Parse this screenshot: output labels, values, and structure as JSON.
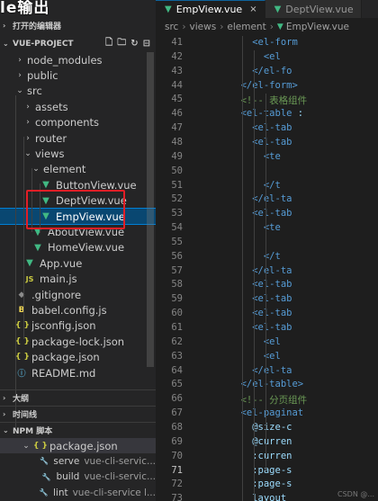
{
  "overlay_title": "le输出",
  "explorer": {
    "open_editors_label": "打开的编辑器",
    "project_label": "VUE-PROJECT",
    "tree": [
      {
        "label": "node_modules",
        "kind": "folder",
        "depth": 1,
        "expanded": false
      },
      {
        "label": "public",
        "kind": "folder",
        "depth": 1,
        "expanded": false
      },
      {
        "label": "src",
        "kind": "folder",
        "depth": 1,
        "expanded": true
      },
      {
        "label": "assets",
        "kind": "folder",
        "depth": 2,
        "expanded": false
      },
      {
        "label": "components",
        "kind": "folder",
        "depth": 2,
        "expanded": false
      },
      {
        "label": "router",
        "kind": "folder",
        "depth": 2,
        "expanded": false
      },
      {
        "label": "views",
        "kind": "folder",
        "depth": 2,
        "expanded": true
      },
      {
        "label": "element",
        "kind": "folder",
        "depth": 3,
        "expanded": true
      },
      {
        "label": "ButtonView.vue",
        "kind": "vue",
        "depth": 4
      },
      {
        "label": "DeptView.vue",
        "kind": "vue",
        "depth": 4
      },
      {
        "label": "EmpView.vue",
        "kind": "vue",
        "depth": 4,
        "selected": true
      },
      {
        "label": "AboutView.vue",
        "kind": "vue",
        "depth": 3
      },
      {
        "label": "HomeView.vue",
        "kind": "vue",
        "depth": 3
      },
      {
        "label": "App.vue",
        "kind": "vue",
        "depth": 2
      },
      {
        "label": "main.js",
        "kind": "js",
        "depth": 2
      },
      {
        "label": ".gitignore",
        "kind": "git",
        "depth": 1
      },
      {
        "label": "babel.config.js",
        "kind": "babel",
        "depth": 1
      },
      {
        "label": "jsconfig.json",
        "kind": "json",
        "depth": 1
      },
      {
        "label": "package-lock.json",
        "kind": "json",
        "depth": 1
      },
      {
        "label": "package.json",
        "kind": "json",
        "depth": 1
      },
      {
        "label": "README.md",
        "kind": "info",
        "depth": 1
      }
    ],
    "outline_label": "大纲",
    "timeline_label": "时间线",
    "npm_label": "NPM 脚本",
    "npm_package": "package.json",
    "npm_scripts": [
      {
        "name": "serve",
        "cmd": "vue-cli-servic..."
      },
      {
        "name": "build",
        "cmd": "vue-cli-servic..."
      },
      {
        "name": "lint",
        "cmd": "vue-cli-service l..."
      }
    ]
  },
  "tabs": [
    {
      "label": "EmpView.vue",
      "active": true,
      "close": "×"
    },
    {
      "label": "DeptView.vue",
      "active": false
    }
  ],
  "breadcrumb": [
    "src",
    "views",
    "element",
    "EmpView.vue"
  ],
  "editor": {
    "current_line": 71,
    "lines": [
      {
        "n": "41",
        "indent": 10,
        "parts": [
          {
            "c": "tg",
            "t": "<el-form"
          }
        ]
      },
      {
        "n": "42",
        "indent": 12,
        "parts": [
          {
            "c": "tg",
            "t": "<el"
          }
        ]
      },
      {
        "n": "43",
        "indent": 10,
        "parts": [
          {
            "c": "tg",
            "t": "</el-fo"
          }
        ]
      },
      {
        "n": "44",
        "indent": 8,
        "parts": [
          {
            "c": "tg",
            "t": "</el-form>"
          }
        ]
      },
      {
        "n": "45",
        "indent": 8,
        "parts": [
          {
            "c": "cm",
            "t": "<!-- 表格组件"
          }
        ]
      },
      {
        "n": "46",
        "indent": 8,
        "parts": [
          {
            "c": "tg",
            "t": "<el-table"
          },
          {
            "c": "at",
            "t": " :"
          }
        ]
      },
      {
        "n": "47",
        "indent": 10,
        "parts": [
          {
            "c": "tg",
            "t": "<el-tab"
          }
        ]
      },
      {
        "n": "48",
        "indent": 10,
        "parts": [
          {
            "c": "tg",
            "t": "<el-tab"
          }
        ]
      },
      {
        "n": "49",
        "indent": 12,
        "parts": [
          {
            "c": "tg",
            "t": "<te"
          }
        ]
      },
      {
        "n": "50",
        "indent": 12,
        "parts": []
      },
      {
        "n": "51",
        "indent": 12,
        "parts": [
          {
            "c": "tg",
            "t": "</t"
          }
        ]
      },
      {
        "n": "52",
        "indent": 10,
        "parts": [
          {
            "c": "tg",
            "t": "</el-ta"
          }
        ]
      },
      {
        "n": "53",
        "indent": 10,
        "parts": [
          {
            "c": "tg",
            "t": "<el-tab"
          }
        ]
      },
      {
        "n": "54",
        "indent": 12,
        "parts": [
          {
            "c": "tg",
            "t": "<te"
          }
        ]
      },
      {
        "n": "55",
        "indent": 12,
        "parts": []
      },
      {
        "n": "56",
        "indent": 12,
        "parts": [
          {
            "c": "tg",
            "t": "</t"
          }
        ]
      },
      {
        "n": "57",
        "indent": 10,
        "parts": [
          {
            "c": "tg",
            "t": "</el-ta"
          }
        ]
      },
      {
        "n": "58",
        "indent": 10,
        "parts": [
          {
            "c": "tg",
            "t": "<el-tab"
          }
        ]
      },
      {
        "n": "59",
        "indent": 10,
        "parts": [
          {
            "c": "tg",
            "t": "<el-tab"
          }
        ]
      },
      {
        "n": "60",
        "indent": 10,
        "parts": [
          {
            "c": "tg",
            "t": "<el-tab"
          }
        ]
      },
      {
        "n": "61",
        "indent": 10,
        "parts": [
          {
            "c": "tg",
            "t": "<el-tab"
          }
        ]
      },
      {
        "n": "62",
        "indent": 12,
        "parts": [
          {
            "c": "tg",
            "t": "<el"
          }
        ]
      },
      {
        "n": "63",
        "indent": 12,
        "parts": [
          {
            "c": "tg",
            "t": "<el"
          }
        ]
      },
      {
        "n": "64",
        "indent": 10,
        "parts": [
          {
            "c": "tg",
            "t": "</el-ta"
          }
        ]
      },
      {
        "n": "65",
        "indent": 8,
        "parts": [
          {
            "c": "tg",
            "t": "</el-table>"
          }
        ]
      },
      {
        "n": "66",
        "indent": 8,
        "parts": [
          {
            "c": "cm",
            "t": "<!-- 分页组件"
          }
        ]
      },
      {
        "n": "67",
        "indent": 8,
        "parts": [
          {
            "c": "tg",
            "t": "<el-paginat"
          }
        ]
      },
      {
        "n": "68",
        "indent": 10,
        "parts": [
          {
            "c": "at",
            "t": "@size-c"
          }
        ]
      },
      {
        "n": "69",
        "indent": 10,
        "parts": [
          {
            "c": "at",
            "t": "@curren"
          }
        ]
      },
      {
        "n": "70",
        "indent": 10,
        "parts": [
          {
            "c": "at",
            "t": ":curren"
          }
        ]
      },
      {
        "n": "71",
        "indent": 10,
        "parts": [
          {
            "c": "at",
            "t": ":page-s"
          }
        ]
      },
      {
        "n": "72",
        "indent": 10,
        "parts": [
          {
            "c": "at",
            "t": ":page-s"
          }
        ]
      },
      {
        "n": "73",
        "indent": 10,
        "parts": [
          {
            "c": "at",
            "t": "layout"
          }
        ]
      }
    ]
  },
  "watermark": "CSDN @..."
}
